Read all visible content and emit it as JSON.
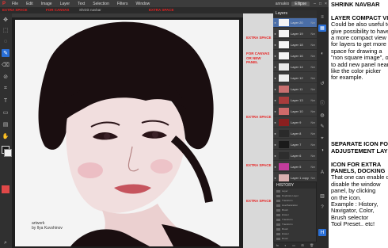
{
  "menubar": {
    "logo": "P",
    "items": [
      "File",
      "Edit",
      "Image",
      "Layer",
      "Text",
      "Selection",
      "Filters",
      "Window"
    ],
    "user": "annakio",
    "mode_label": "Ellipse",
    "window_buttons": [
      "–",
      "□",
      "×"
    ]
  },
  "annotations": {
    "extra_space_top_left": "EXTRA SPACE",
    "for_canvas_top": "FOR CANVAS",
    "shrink_navbar_small": "Shrink navbar",
    "extra_space_top_right": "EXTRA SPACE",
    "extra_space_1": "EXTRA SPACE",
    "for_canvas_side": [
      "FOR CANVAS",
      "OR NEW",
      "PANEL"
    ],
    "extra_space_2": "EXTRA SPACE",
    "extra_space_3": "EXTRA SPACE",
    "extra_space_4": "EXTRA SPACE"
  },
  "toolbar_icons": [
    "move-icon",
    "marquee-icon",
    "lasso-icon",
    "brush-icon",
    "eraser-icon",
    "eyedropper-icon",
    "crop-icon",
    "text-icon",
    "shape-icon",
    "gradient-icon",
    "hand-icon",
    "zoom-icon"
  ],
  "canvas": {
    "signature_line1": "artwork",
    "signature_line2": "by Ilya Kuvshinov"
  },
  "layers_panel": {
    "title": "Layers",
    "layers": [
      {
        "name": "Layer 20",
        "mode": "Nm",
        "thumb": "#f4f4f4"
      },
      {
        "name": "Layer 19",
        "mode": "Nm",
        "thumb": "#f4f4f4"
      },
      {
        "name": "Layer 18",
        "mode": "Nm",
        "thumb": "#f4f4f4"
      },
      {
        "name": "Layer 16",
        "mode": "Nm",
        "thumb": "#f4f4f4"
      },
      {
        "name": "Layer 14",
        "mode": "Nm",
        "thumb": "#e9e9e9"
      },
      {
        "name": "Layer 12",
        "mode": "Nm",
        "thumb": "#eeeeee"
      },
      {
        "name": "Layer 11",
        "mode": "Nm",
        "thumb": "#c87070"
      },
      {
        "name": "Layer 13",
        "mode": "Nm",
        "thumb": "#a93c3c"
      },
      {
        "name": "Layer 10",
        "mode": "Nm",
        "thumb": "#cf6a6a"
      },
      {
        "name": "Layer 9",
        "mode": "Nm",
        "thumb": "#8a1f1f"
      },
      {
        "name": "Layer 8",
        "mode": "Nm",
        "thumb": "#2a2a2a"
      },
      {
        "name": "Layer 7",
        "mode": "Nm",
        "thumb": "#1a1a1a"
      },
      {
        "name": "Layer 6",
        "mode": "Nm",
        "thumb": "#2d2d2d"
      },
      {
        "name": "Layer 5",
        "mode": "Nm",
        "thumb": "#c13c9b"
      },
      {
        "name": "Layer 1 copy",
        "mode": "Nm",
        "thumb": "#d9b0b0"
      }
    ]
  },
  "history_panel": {
    "title": "HISTORY",
    "rows": [
      "Layer",
      "Duplicate Layer",
      "Transform",
      "Hue/Saturation",
      "Brush",
      "Eraser",
      "Transform",
      "Transform",
      "Brush",
      "Eraser",
      "Brush",
      "Brush",
      "Brush"
    ]
  },
  "panel_footer": [
    "fx",
    "◐",
    "▭",
    "⊞",
    "🗑"
  ],
  "right_icons": [
    "navbar-toggle-icon",
    "layers-panel-icon",
    "adjustment-icon",
    "history-icon",
    "info-icon",
    "color-picker-icon",
    "brush-settings-icon",
    "navigator-icon",
    "adjustments-panel-icon",
    "character-icon",
    "swatches-icon",
    "help-icon",
    "expand-panel-icon"
  ],
  "notes": {
    "lines": [
      {
        "text": "SHRINK NAVBAR",
        "h": true
      },
      {
        "text": "",
        "h": false
      },
      {
        "text": "LAYER COMPACT VIEW",
        "h": true
      },
      {
        "text": "Could be also useful to",
        "h": false
      },
      {
        "text": "give possibility to have",
        "h": false
      },
      {
        "text": "a more compact view",
        "h": false
      },
      {
        "text": "for layers to get more",
        "h": false
      },
      {
        "text": "space for drawing a",
        "h": false
      },
      {
        "text": "\"non square image\", or",
        "h": false
      },
      {
        "text": "to add new panel near,",
        "h": false
      },
      {
        "text": "like the color picker",
        "h": false
      },
      {
        "text": "for example.",
        "h": false
      },
      {
        "text": "",
        "h": false
      },
      {
        "text": "",
        "h": false
      },
      {
        "text": "",
        "h": false
      },
      {
        "text": "",
        "h": false
      },
      {
        "text": "",
        "h": false
      },
      {
        "text": "",
        "h": false
      },
      {
        "text": "",
        "h": false
      },
      {
        "text": "",
        "h": false
      },
      {
        "text": "",
        "h": false
      },
      {
        "text": "SEPARATE ICON FOR",
        "h": true
      },
      {
        "text": "ADJUSTEMENT LAYERS",
        "h": true
      },
      {
        "text": "",
        "h": false
      },
      {
        "text": "ICON FOR EXTRA",
        "h": true
      },
      {
        "text": "PANELS, DOCKING",
        "h": true
      },
      {
        "text": "That one can enable or",
        "h": false
      },
      {
        "text": "disable the window",
        "h": false
      },
      {
        "text": "panel, by clicking",
        "h": false
      },
      {
        "text": "on the icon.",
        "h": false
      },
      {
        "text": "Example : History,",
        "h": false
      },
      {
        "text": "Navigator, Color,",
        "h": false
      },
      {
        "text": "Brush selector",
        "h": false
      },
      {
        "text": "Tool Preset.. etc!",
        "h": false
      }
    ]
  },
  "colors": {
    "accent": "#2a6fd6",
    "annotation": "#e62222"
  }
}
